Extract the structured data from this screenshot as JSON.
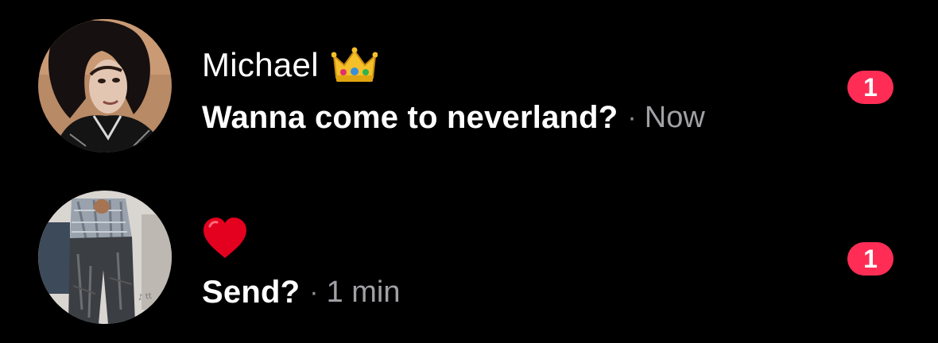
{
  "conversations": [
    {
      "name": "Michael",
      "name_emoji": "crown-emoji",
      "preview": "Wanna come to neverland?",
      "separator": "·",
      "time": "Now",
      "unread_count": "1"
    },
    {
      "name_emoji": "red-heart-emoji",
      "preview": "Send?",
      "separator": "·",
      "time": "1 min",
      "unread_count": "1"
    }
  ],
  "colors": {
    "background": "#000000",
    "badge": "#ff2d55",
    "secondary_text": "#a0a0a5"
  }
}
